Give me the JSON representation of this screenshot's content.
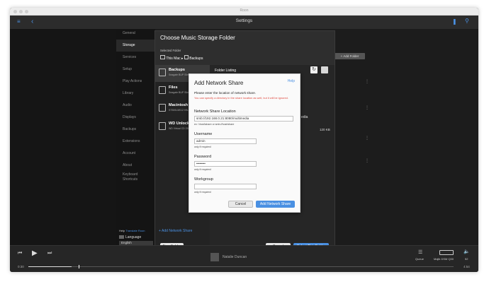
{
  "window": {
    "title": "Roon"
  },
  "topbar": {
    "title": "Settings"
  },
  "sidebar": {
    "items": [
      {
        "label": "General"
      },
      {
        "label": "Storage"
      },
      {
        "label": "Services"
      },
      {
        "label": "Setup"
      },
      {
        "label": "Play Actions"
      },
      {
        "label": "Library"
      },
      {
        "label": "Audio"
      },
      {
        "label": "Displays"
      },
      {
        "label": "Backups"
      },
      {
        "label": "Extensions"
      },
      {
        "label": "Account"
      },
      {
        "label": "About"
      },
      {
        "label": "Keyboard"
      },
      {
        "label": "Shortcuts"
      }
    ],
    "help": "Help",
    "translate": "Translate Roon",
    "language_label": "Language",
    "language_value": "English"
  },
  "background": {
    "add_folder": "Add Folder",
    "size": "120 KB",
    "media_text": "edia",
    "track_artist": "Natalie Duncan"
  },
  "dialog": {
    "title": "Choose Music Storage Folder",
    "selected_label": "Selected Folder",
    "crumb_1": "This Mac",
    "crumb_sep": "▸",
    "crumb_2": "Backups",
    "listing_label": "Folder Listing",
    "locations": [
      {
        "name": "Backups",
        "sub": "Seagate BUP Slim SL Media"
      },
      {
        "name": "Files",
        "sub": "Seagate BUP Slim SL Media"
      },
      {
        "name": "Macintosh HD",
        "sub": "ST500LM012 HN-M500MBB Media"
      },
      {
        "name": "WD Unlocker",
        "sub": "WD Virtual CD 255 Media"
      }
    ],
    "add_share": "Add Network Share",
    "new_folder": "New Folder",
    "cancel": "Cancel",
    "select": "Select This Folder"
  },
  "share": {
    "title": "Add Network Share",
    "help": "Help",
    "intro": "Please enter the location of network share.",
    "note": "You can specify a directory in the share location as well, but it will be ignored.",
    "location_label": "Network Share Location",
    "location_value": "smb://192.168.0.21:8080/multimedia",
    "location_hint": "ex: \\\\host\\share or smb://host/share",
    "username_label": "Username",
    "username_value": "admin",
    "username_hint": "only if required",
    "password_label": "Password",
    "password_value": "••••••••",
    "password_hint": "only if required",
    "workgroup_label": "Workgroup",
    "workgroup_value": "",
    "workgroup_hint": "only if required",
    "cancel": "Cancel",
    "submit": "Add Network Share"
  },
  "player": {
    "elapsed": "0:30",
    "total": "4:54",
    "queue": "Queue",
    "zone": "Majik DSM Q30",
    "volume": "52"
  },
  "colors": {
    "accent": "#4a90e2",
    "warning": "#e0483e"
  }
}
